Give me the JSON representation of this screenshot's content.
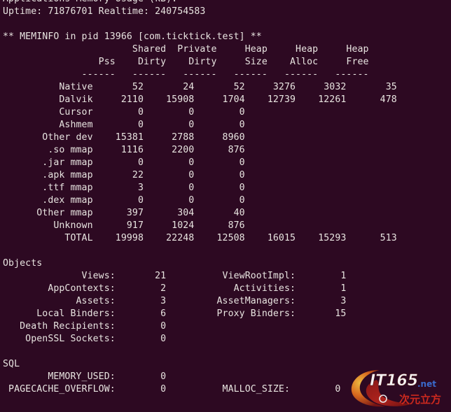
{
  "terminal": {
    "background_color": "#2d0922",
    "text_color": "#e8e4e0",
    "partial_top_line": "                ",
    "header": {
      "title_line": "Applications Memory Usage (kB):",
      "uptime_line": "Uptime: 71876701 Realtime: 240754583",
      "meminfo_line": "** MEMINFO in pid 13966 [com.ticktick.test] **"
    },
    "meminfo_table": {
      "header_row_1": "                       Shared  Private     Heap     Heap     Heap",
      "header_row_2": "                 Pss    Dirty    Dirty     Size    Alloc     Free",
      "rule_row": "              ------   ------   ------   ------   ------   ------",
      "columns": [
        "",
        "Pss",
        "Shared Dirty",
        "Private Dirty",
        "Heap Size",
        "Heap Alloc",
        "Heap Free"
      ],
      "rows": [
        {
          "label": "Native",
          "pss": "52",
          "shared_dirty": "24",
          "private_dirty": "52",
          "heap_size": "3276",
          "heap_alloc": "3032",
          "heap_free": "35"
        },
        {
          "label": "Dalvik",
          "pss": "2110",
          "shared_dirty": "15908",
          "private_dirty": "1704",
          "heap_size": "12739",
          "heap_alloc": "12261",
          "heap_free": "478"
        },
        {
          "label": "Cursor",
          "pss": "0",
          "shared_dirty": "0",
          "private_dirty": "0",
          "heap_size": "",
          "heap_alloc": "",
          "heap_free": ""
        },
        {
          "label": "Ashmem",
          "pss": "0",
          "shared_dirty": "0",
          "private_dirty": "0",
          "heap_size": "",
          "heap_alloc": "",
          "heap_free": ""
        },
        {
          "label": "Other dev",
          "pss": "15381",
          "shared_dirty": "2788",
          "private_dirty": "8960",
          "heap_size": "",
          "heap_alloc": "",
          "heap_free": ""
        },
        {
          "label": ".so mmap",
          "pss": "1116",
          "shared_dirty": "2200",
          "private_dirty": "876",
          "heap_size": "",
          "heap_alloc": "",
          "heap_free": ""
        },
        {
          "label": ".jar mmap",
          "pss": "0",
          "shared_dirty": "0",
          "private_dirty": "0",
          "heap_size": "",
          "heap_alloc": "",
          "heap_free": ""
        },
        {
          "label": ".apk mmap",
          "pss": "22",
          "shared_dirty": "0",
          "private_dirty": "0",
          "heap_size": "",
          "heap_alloc": "",
          "heap_free": ""
        },
        {
          "label": ".ttf mmap",
          "pss": "3",
          "shared_dirty": "0",
          "private_dirty": "0",
          "heap_size": "",
          "heap_alloc": "",
          "heap_free": ""
        },
        {
          "label": ".dex mmap",
          "pss": "0",
          "shared_dirty": "0",
          "private_dirty": "0",
          "heap_size": "",
          "heap_alloc": "",
          "heap_free": ""
        },
        {
          "label": "Other mmap",
          "pss": "397",
          "shared_dirty": "304",
          "private_dirty": "40",
          "heap_size": "",
          "heap_alloc": "",
          "heap_free": ""
        },
        {
          "label": "Unknown",
          "pss": "917",
          "shared_dirty": "1024",
          "private_dirty": "876",
          "heap_size": "",
          "heap_alloc": "",
          "heap_free": ""
        },
        {
          "label": "TOTAL",
          "pss": "19998",
          "shared_dirty": "22248",
          "private_dirty": "12508",
          "heap_size": "16015",
          "heap_alloc": "15293",
          "heap_free": "513"
        }
      ],
      "rendered_rows": [
        "          Native       52       24       52     3276     3032       35",
        "          Dalvik     2110    15908     1704    12739    12261      478",
        "          Cursor        0        0        0",
        "          Ashmem        0        0        0",
        "       Other dev    15381     2788     8960",
        "        .so mmap     1116     2200      876",
        "       .jar mmap        0        0        0",
        "       .apk mmap       22        0        0",
        "       .ttf mmap        3        0        0",
        "       .dex mmap        0        0        0",
        "      Other mmap      397      304       40",
        "         Unknown      917     1024      876",
        "           TOTAL    19998    22248    12508    16015    15293      513"
      ]
    },
    "objects": {
      "section_title": "Objects",
      "entries": [
        {
          "left_label": "Views:",
          "left_value": "21",
          "right_label": "ViewRootImpl:",
          "right_value": "1"
        },
        {
          "left_label": "AppContexts:",
          "left_value": "2",
          "right_label": "Activities:",
          "right_value": "1"
        },
        {
          "left_label": "Assets:",
          "left_value": "3",
          "right_label": "AssetManagers:",
          "right_value": "3"
        },
        {
          "left_label": "Local Binders:",
          "left_value": "6",
          "right_label": "Proxy Binders:",
          "right_value": "15"
        },
        {
          "left_label": "Death Recipients:",
          "left_value": "0",
          "right_label": "",
          "right_value": ""
        },
        {
          "left_label": "OpenSSL Sockets:",
          "left_value": "0",
          "right_label": "",
          "right_value": ""
        }
      ],
      "rendered_rows": [
        "              Views:       21          ViewRootImpl:        1",
        "        AppContexts:        2            Activities:        1",
        "             Assets:        3         AssetManagers:        3",
        "      Local Binders:        6         Proxy Binders:       15",
        "   Death Recipients:        0",
        "    OpenSSL Sockets:        0"
      ]
    },
    "sql": {
      "section_title": "SQL",
      "entries": [
        {
          "left_label": "MEMORY_USED:",
          "left_value": "0",
          "right_label": "",
          "right_value": ""
        },
        {
          "left_label": "PAGECACHE_OVERFLOW:",
          "left_value": "0",
          "right_label": "MALLOC_SIZE:",
          "right_value": "0"
        }
      ],
      "rendered_rows": [
        "        MEMORY_USED:        0",
        " PAGECACHE_OVERFLOW:        0          MALLOC_SIZE:        0"
      ]
    },
    "watermark": {
      "brand": "IT165",
      "domain": ".net",
      "subtitle": "次元立方",
      "brand_color": "#ffffff",
      "domain_color": "#3b6fd4",
      "subtitle_color": "#d52b1e",
      "swoosh_color": "#c0392b",
      "glow_color": "#e8a020"
    }
  }
}
